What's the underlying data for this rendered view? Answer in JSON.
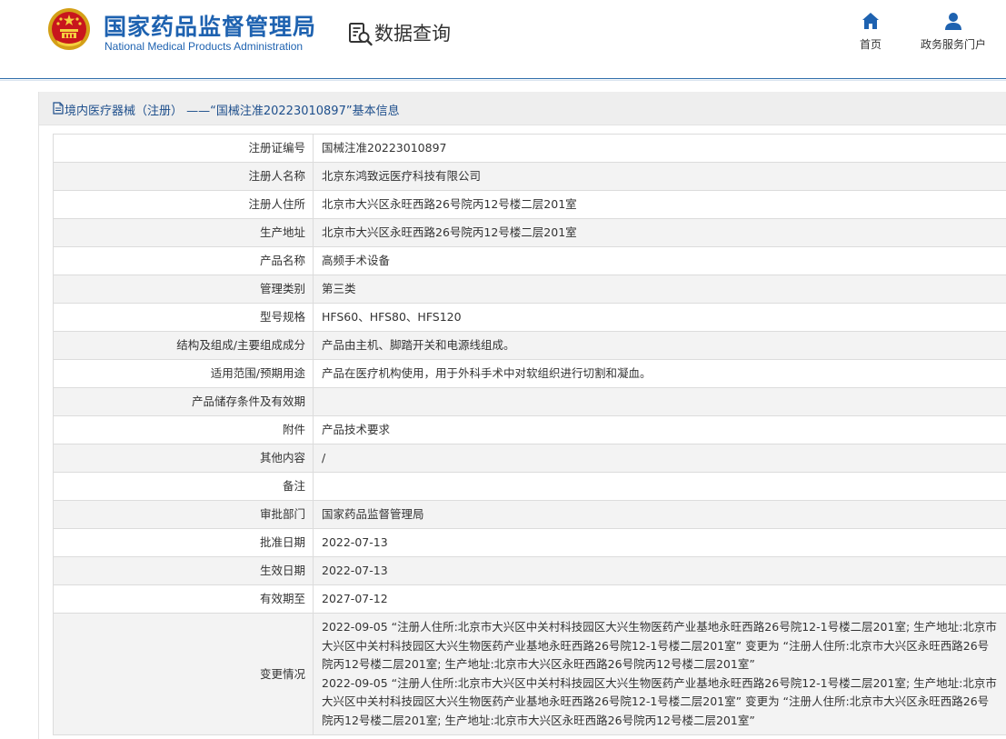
{
  "header": {
    "agency_cn": "国家药品监督管理局",
    "agency_en": "National Medical Products Administration",
    "query_title": "数据查询",
    "nav": [
      {
        "label": "首页",
        "icon": "home-icon"
      },
      {
        "label": "政务服务门户",
        "icon": "user-icon"
      }
    ],
    "accent": "#1e62b0"
  },
  "panel": {
    "title": "境内医疗器械（注册） ——“国械注准20223010897”基本信息"
  },
  "rows": [
    {
      "label": "注册证编号",
      "value": "国械注准20223010897"
    },
    {
      "label": "注册人名称",
      "value": "北京东鸿致远医疗科技有限公司"
    },
    {
      "label": "注册人住所",
      "value": "北京市大兴区永旺西路26号院丙12号楼二层201室"
    },
    {
      "label": "生产地址",
      "value": "北京市大兴区永旺西路26号院丙12号楼二层201室"
    },
    {
      "label": "产品名称",
      "value": "高频手术设备"
    },
    {
      "label": "管理类别",
      "value": "第三类"
    },
    {
      "label": "型号规格",
      "value": "HFS60、HFS80、HFS120"
    },
    {
      "label": "结构及组成/主要组成成分",
      "value": "产品由主机、脚踏开关和电源线组成。"
    },
    {
      "label": "适用范围/预期用途",
      "value": "产品在医疗机构使用，用于外科手术中对软组织进行切割和凝血。"
    },
    {
      "label": "产品储存条件及有效期",
      "value": ""
    },
    {
      "label": "附件",
      "value": "产品技术要求"
    },
    {
      "label": "其他内容",
      "value": "/"
    },
    {
      "label": "备注",
      "value": ""
    },
    {
      "label": "审批部门",
      "value": "国家药品监督管理局"
    },
    {
      "label": "批准日期",
      "value": "2022-07-13"
    },
    {
      "label": "生效日期",
      "value": "2022-07-13"
    },
    {
      "label": "有效期至",
      "value": "2027-07-12"
    }
  ],
  "changes": {
    "label": "变更情况",
    "lines": [
      "2022-09-05 “注册人住所:北京市大兴区中关村科技园区大兴生物医药产业基地永旺西路26号院12-1号楼二层201室; 生产地址:北京市",
      "大兴区中关村科技园区大兴生物医药产业基地永旺西路26号院12-1号楼二层201室” 变更为 “注册人住所:北京市大兴区永旺西路26号",
      "院丙12号楼二层201室; 生产地址:北京市大兴区永旺西路26号院丙12号楼二层201室”",
      "2022-09-05 “注册人住所:北京市大兴区中关村科技园区大兴生物医药产业基地永旺西路26号院12-1号楼二层201室; 生产地址:北京市",
      "大兴区中关村科技园区大兴生物医药产业基地永旺西路26号院12-1号楼二层201室” 变更为 “注册人住所:北京市大兴区永旺西路26号",
      "院丙12号楼二层201室; 生产地址:北京市大兴区永旺西路26号院丙12号楼二层201室”"
    ]
  }
}
